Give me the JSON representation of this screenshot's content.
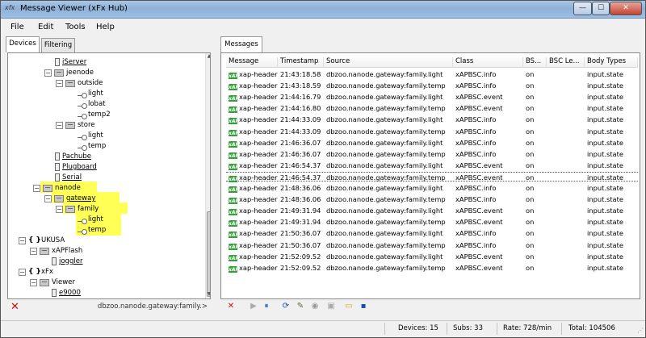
{
  "window": {
    "title": "Message Viewer (xFx Hub)",
    "icon_text": "xfx",
    "controls": {
      "minimize": "—",
      "maximize": "☐",
      "close": "✕"
    }
  },
  "menu": [
    "File",
    "Edit",
    "Tools",
    "Help"
  ],
  "left_panel": {
    "tabs": [
      "Devices",
      "Filtering"
    ],
    "active_tab": "Devices",
    "tree": [
      {
        "label": "iServer",
        "icon": "server-icon",
        "link": true
      },
      {
        "label": "jeenode",
        "icon": "folder-icon",
        "expander": "−"
      },
      {
        "label": "outside",
        "icon": "folder-icon",
        "expander": "−"
      },
      {
        "label": "light",
        "icon": "leaf-icon"
      },
      {
        "label": "lobat",
        "icon": "leaf-icon"
      },
      {
        "label": "temp2",
        "icon": "leaf-icon"
      },
      {
        "label": "store",
        "icon": "folder-icon",
        "expander": "−"
      },
      {
        "label": "light",
        "icon": "leaf-icon"
      },
      {
        "label": "temp",
        "icon": "leaf-icon"
      },
      {
        "label": "Pachube",
        "icon": "server-icon",
        "link": true
      },
      {
        "label": "Plugboard",
        "icon": "server-icon",
        "link": true
      },
      {
        "label": "Serial",
        "icon": "server-icon",
        "link": true
      },
      {
        "label": "nanode",
        "icon": "folder-icon",
        "expander": "−",
        "highlight": true
      },
      {
        "label": "gateway",
        "icon": "folder-icon",
        "expander": "−",
        "highlight": true,
        "link": true
      },
      {
        "label": "family",
        "icon": "folder-icon",
        "expander": "−",
        "highlight": true
      },
      {
        "label": "light",
        "icon": "leaf-icon",
        "highlight": true
      },
      {
        "label": "temp",
        "icon": "leaf-icon",
        "highlight": true
      },
      {
        "label": "UKUSA",
        "icon": "brace-icon",
        "expander": "−",
        "brace": "{ }"
      },
      {
        "label": "xAPFlash",
        "icon": "folder-icon",
        "expander": "−"
      },
      {
        "label": "joggler",
        "icon": "server-icon",
        "link": true
      },
      {
        "label": "xFx",
        "icon": "brace-icon",
        "expander": "−",
        "brace": "{ }"
      },
      {
        "label": "Viewer",
        "icon": "folder-icon",
        "expander": "−"
      },
      {
        "label": "e9000",
        "icon": "server-icon",
        "link": true
      }
    ],
    "filter_path": "dbzoo.nanode.gateway:family.>"
  },
  "right_panel": {
    "tab": "Messages",
    "columns": [
      "Message",
      "Timestamp",
      "Source",
      "Class",
      "BS...",
      "BSC Le...",
      "Body Types"
    ],
    "rows": [
      [
        "xap-header",
        "21:43:18.58",
        "dbzoo.nanode.gateway:family.light",
        "xAPBSC.info",
        "on",
        "",
        "input.state"
      ],
      [
        "xap-header",
        "21:43:18.59",
        "dbzoo.nanode.gateway:family.temp",
        "xAPBSC.info",
        "on",
        "",
        "input.state"
      ],
      [
        "xap-header",
        "21:44:16.79",
        "dbzoo.nanode.gateway:family.light",
        "xAPBSC.event",
        "on",
        "",
        "input.state"
      ],
      [
        "xap-header",
        "21:44:16.80",
        "dbzoo.nanode.gateway:family.temp",
        "xAPBSC.event",
        "on",
        "",
        "input.state"
      ],
      [
        "xap-header",
        "21:44:33.09",
        "dbzoo.nanode.gateway:family.light",
        "xAPBSC.info",
        "on",
        "",
        "input.state"
      ],
      [
        "xap-header",
        "21:44:33.09",
        "dbzoo.nanode.gateway:family.temp",
        "xAPBSC.info",
        "on",
        "",
        "input.state"
      ],
      [
        "xap-header",
        "21:46:36.07",
        "dbzoo.nanode.gateway:family.light",
        "xAPBSC.info",
        "on",
        "",
        "input.state"
      ],
      [
        "xap-header",
        "21:46:36.07",
        "dbzoo.nanode.gateway:family.temp",
        "xAPBSC.info",
        "on",
        "",
        "input.state"
      ],
      [
        "xap-header",
        "21:46:54.37",
        "dbzoo.nanode.gateway:family.light",
        "xAPBSC.event",
        "on",
        "",
        "input.state"
      ],
      [
        "xap-header",
        "21:46:54.37",
        "dbzoo.nanode.gateway:family.temp",
        "xAPBSC.event",
        "on",
        "",
        "input.state"
      ],
      [
        "xap-header",
        "21:48:36.06",
        "dbzoo.nanode.gateway:family.light",
        "xAPBSC.info",
        "on",
        "",
        "input.state"
      ],
      [
        "xap-header",
        "21:48:36.06",
        "dbzoo.nanode.gateway:family.temp",
        "xAPBSC.info",
        "on",
        "",
        "input.state"
      ],
      [
        "xap-header",
        "21:49:31.94",
        "dbzoo.nanode.gateway:family.light",
        "xAPBSC.event",
        "on",
        "",
        "input.state"
      ],
      [
        "xap-header",
        "21:49:31.94",
        "dbzoo.nanode.gateway:family.temp",
        "xAPBSC.event",
        "on",
        "",
        "input.state"
      ],
      [
        "xap-header",
        "21:50:36.07",
        "dbzoo.nanode.gateway:family.light",
        "xAPBSC.info",
        "on",
        "",
        "input.state"
      ],
      [
        "xap-header",
        "21:50:36.07",
        "dbzoo.nanode.gateway:family.temp",
        "xAPBSC.info",
        "on",
        "",
        "input.state"
      ],
      [
        "xap-header",
        "21:52:09.52",
        "dbzoo.nanode.gateway:family.light",
        "xAPBSC.event",
        "on",
        "",
        "input.state"
      ],
      [
        "xap-header",
        "21:52:09.52",
        "dbzoo.nanode.gateway:family.temp",
        "xAPBSC.event",
        "on",
        "",
        "input.state"
      ]
    ],
    "selected_row": 9,
    "message_icon_text": "xAP",
    "toolbar": [
      {
        "name": "delete-icon",
        "glyph": "✕",
        "color": "#d01010"
      },
      {
        "name": "play-icon",
        "glyph": "▶",
        "color": "#aaaaaa"
      },
      {
        "name": "pause-icon",
        "glyph": "⏸",
        "color": "#1a4fb0"
      },
      {
        "name": "refresh-icon",
        "glyph": "⟳",
        "color": "#1a4fb0"
      },
      {
        "name": "filter-edit-icon",
        "glyph": "✎",
        "color": "#556b2f"
      },
      {
        "name": "broadcast-icon",
        "glyph": "◉",
        "color": "#999999"
      },
      {
        "name": "camera-icon",
        "glyph": "▣",
        "color": "#aaaaaa"
      },
      {
        "name": "open-folder-icon",
        "glyph": "▭",
        "color": "#d4a017"
      },
      {
        "name": "save-icon",
        "glyph": "▪",
        "color": "#1a4fb0"
      }
    ]
  },
  "status": {
    "devices": "Devices: 15",
    "subs": "Subs:  33",
    "rate": "Rate:  728/min",
    "total": "Total:  104506"
  },
  "colors": {
    "highlight": "#ffff55",
    "xap_icon": "#35a03a",
    "delete": "#d01010"
  }
}
